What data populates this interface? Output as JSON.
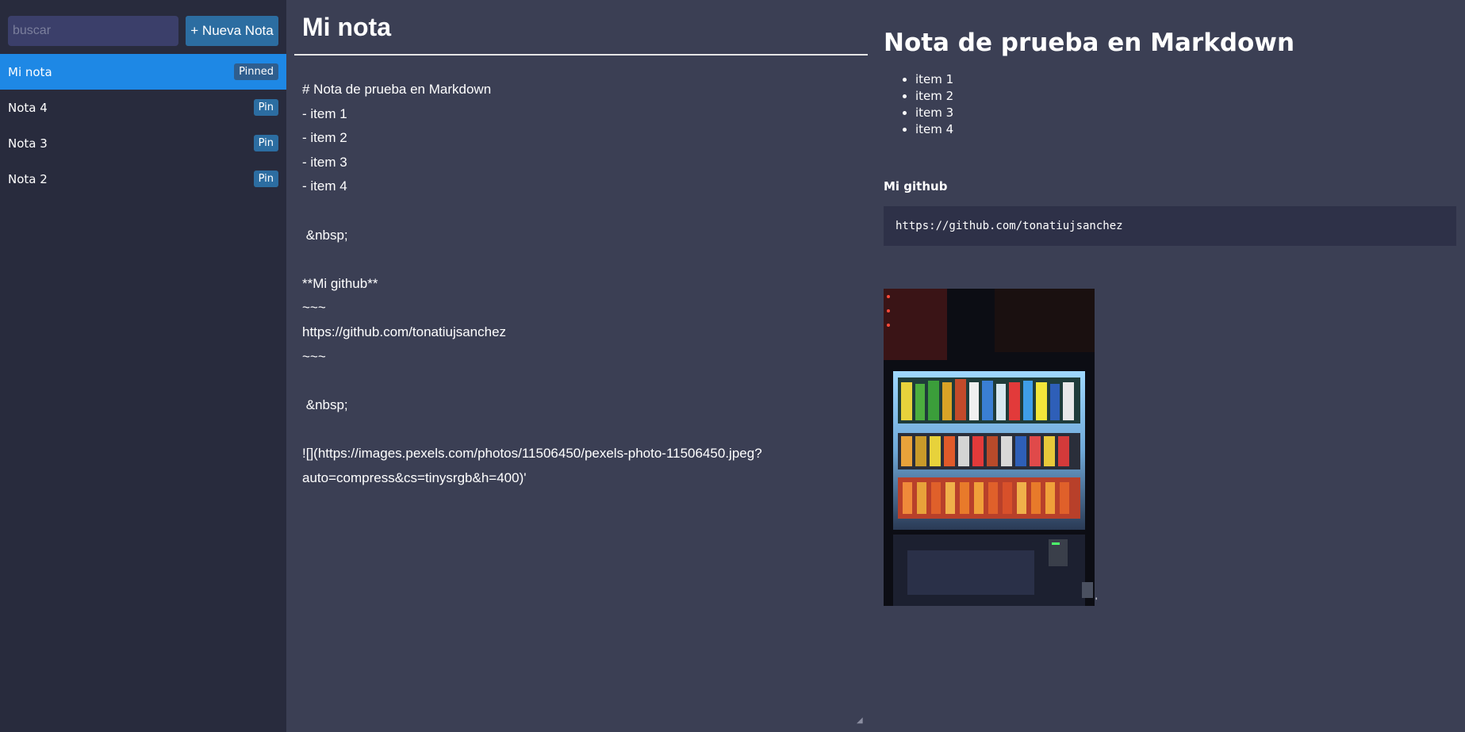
{
  "sidebar": {
    "search_placeholder": "buscar",
    "new_note_label": "+ Nueva Nota",
    "notes": [
      {
        "title": "Mi nota",
        "badge": "Pinned",
        "active": true
      },
      {
        "title": "Nota 4",
        "badge": "Pin",
        "active": false
      },
      {
        "title": "Nota 3",
        "badge": "Pin",
        "active": false
      },
      {
        "title": "Nota 2",
        "badge": "Pin",
        "active": false
      }
    ]
  },
  "editor": {
    "title": "Mi nota",
    "body": "# Nota de prueba en Markdown\n- item 1\n- item 2\n- item 3\n- item 4\n\n &nbsp;\n\n**Mi github**\n~~~\nhttps://github.com/tonatiujsanchez\n~~~\n\n &nbsp;\n\n![](https://images.pexels.com/photos/11506450/pexels-photo-11506450.jpeg?auto=compress&cs=tinysrgb&h=400)'"
  },
  "preview": {
    "heading": "Nota de prueba en Markdown",
    "items": [
      "item 1",
      "item 2",
      "item 3",
      "item 4"
    ],
    "bold_label": "Mi github",
    "code": "https://github.com/tonatiujsanchez",
    "trailing_text": "'"
  },
  "colors": {
    "sidebar_bg": "#282b3d",
    "main_bg": "#3b3f54",
    "active_note": "#1e88e5",
    "button": "#2c6da1",
    "code_bg": "#2e3148"
  }
}
